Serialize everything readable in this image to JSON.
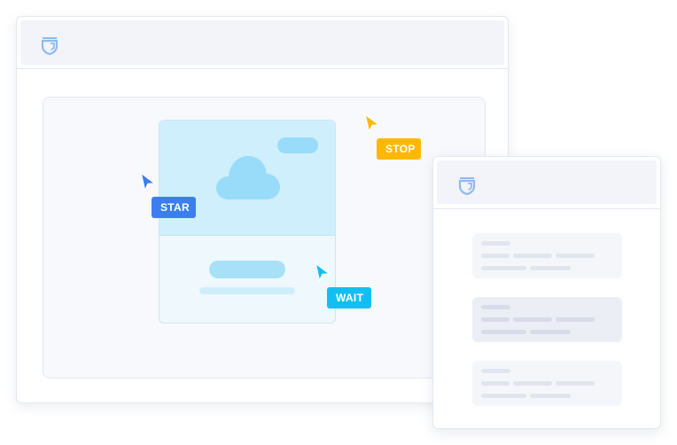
{
  "colors": {
    "star_tag": "#3b7ef0",
    "stop_tag": "#ffb800",
    "wait_tag": "#13bff2",
    "window_titlebar": "#f2f4f9",
    "logo": "#7fb2f0"
  },
  "main_window": {
    "logo_icon": "shield-logo-icon",
    "image_card": {
      "icons": [
        "cloud-icon"
      ]
    }
  },
  "cursors": [
    {
      "label": "STAR",
      "color": "#3b7ef0",
      "icon": "cursor-arrow-icon"
    },
    {
      "label": "STOP",
      "color": "#ffb800",
      "icon": "cursor-arrow-icon"
    },
    {
      "label": "WAIT",
      "color": "#13bff2",
      "icon": "cursor-arrow-icon"
    }
  ],
  "side_window": {
    "logo_icon": "shield-logo-icon",
    "list_items": [
      {
        "state": "default"
      },
      {
        "state": "selected"
      },
      {
        "state": "default"
      }
    ]
  }
}
